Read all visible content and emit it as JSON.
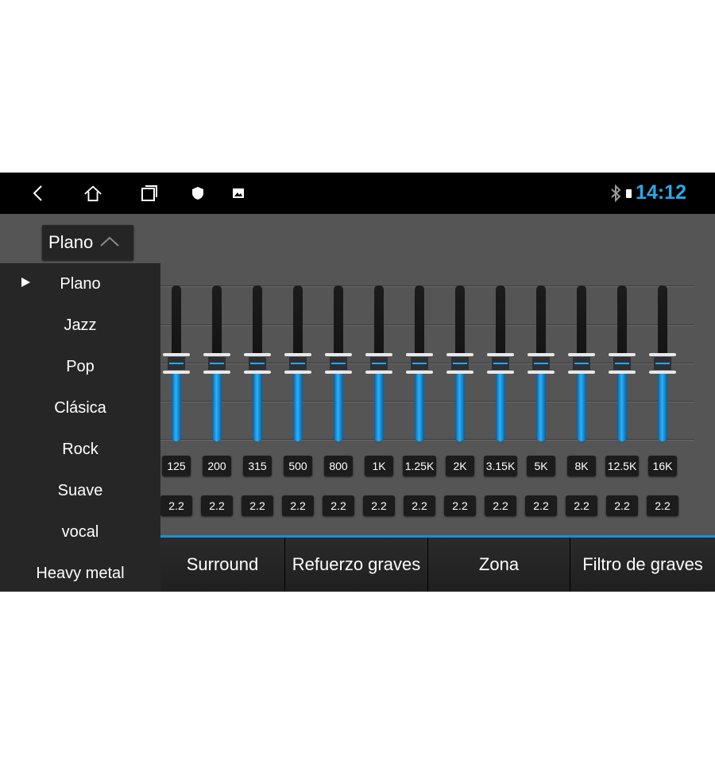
{
  "statusbar": {
    "nav_icons": [
      "back-icon",
      "home-icon",
      "recents-icon",
      "shield-icon",
      "image-icon"
    ],
    "bluetooth_icon": "bluetooth-icon",
    "battery_icon": "battery-icon",
    "time": "14:12"
  },
  "preset": {
    "selected_label": "Plano",
    "chevron_icon": "chevron-up-icon"
  },
  "dropdown": {
    "selected_index": 0,
    "items": [
      {
        "label": "Plano"
      },
      {
        "label": "Jazz"
      },
      {
        "label": "Pop"
      },
      {
        "label": "Clásica"
      },
      {
        "label": "Rock"
      },
      {
        "label": "Suave"
      },
      {
        "label": "vocal"
      },
      {
        "label": "Heavy metal"
      }
    ]
  },
  "equalizer": {
    "level_fraction": 0.5,
    "bands": [
      {
        "freq": "125",
        "value": "2.2"
      },
      {
        "freq": "200",
        "value": "2.2"
      },
      {
        "freq": "315",
        "value": "2.2"
      },
      {
        "freq": "500",
        "value": "2.2"
      },
      {
        "freq": "800",
        "value": "2.2"
      },
      {
        "freq": "1K",
        "value": "2.2"
      },
      {
        "freq": "1.25K",
        "value": "2.2"
      },
      {
        "freq": "2K",
        "value": "2.2"
      },
      {
        "freq": "3.15K",
        "value": "2.2"
      },
      {
        "freq": "5K",
        "value": "2.2"
      },
      {
        "freq": "8K",
        "value": "2.2"
      },
      {
        "freq": "12.5K",
        "value": "2.2"
      },
      {
        "freq": "16K",
        "value": "2.2"
      }
    ]
  },
  "tabs": [
    {
      "label": "Surround"
    },
    {
      "label": "Refuerzo graves"
    },
    {
      "label": "Zona"
    },
    {
      "label": "Filtro de graves"
    }
  ],
  "colors": {
    "accent": "#2aa8e8",
    "background": "#555555",
    "panel": "#262626"
  }
}
